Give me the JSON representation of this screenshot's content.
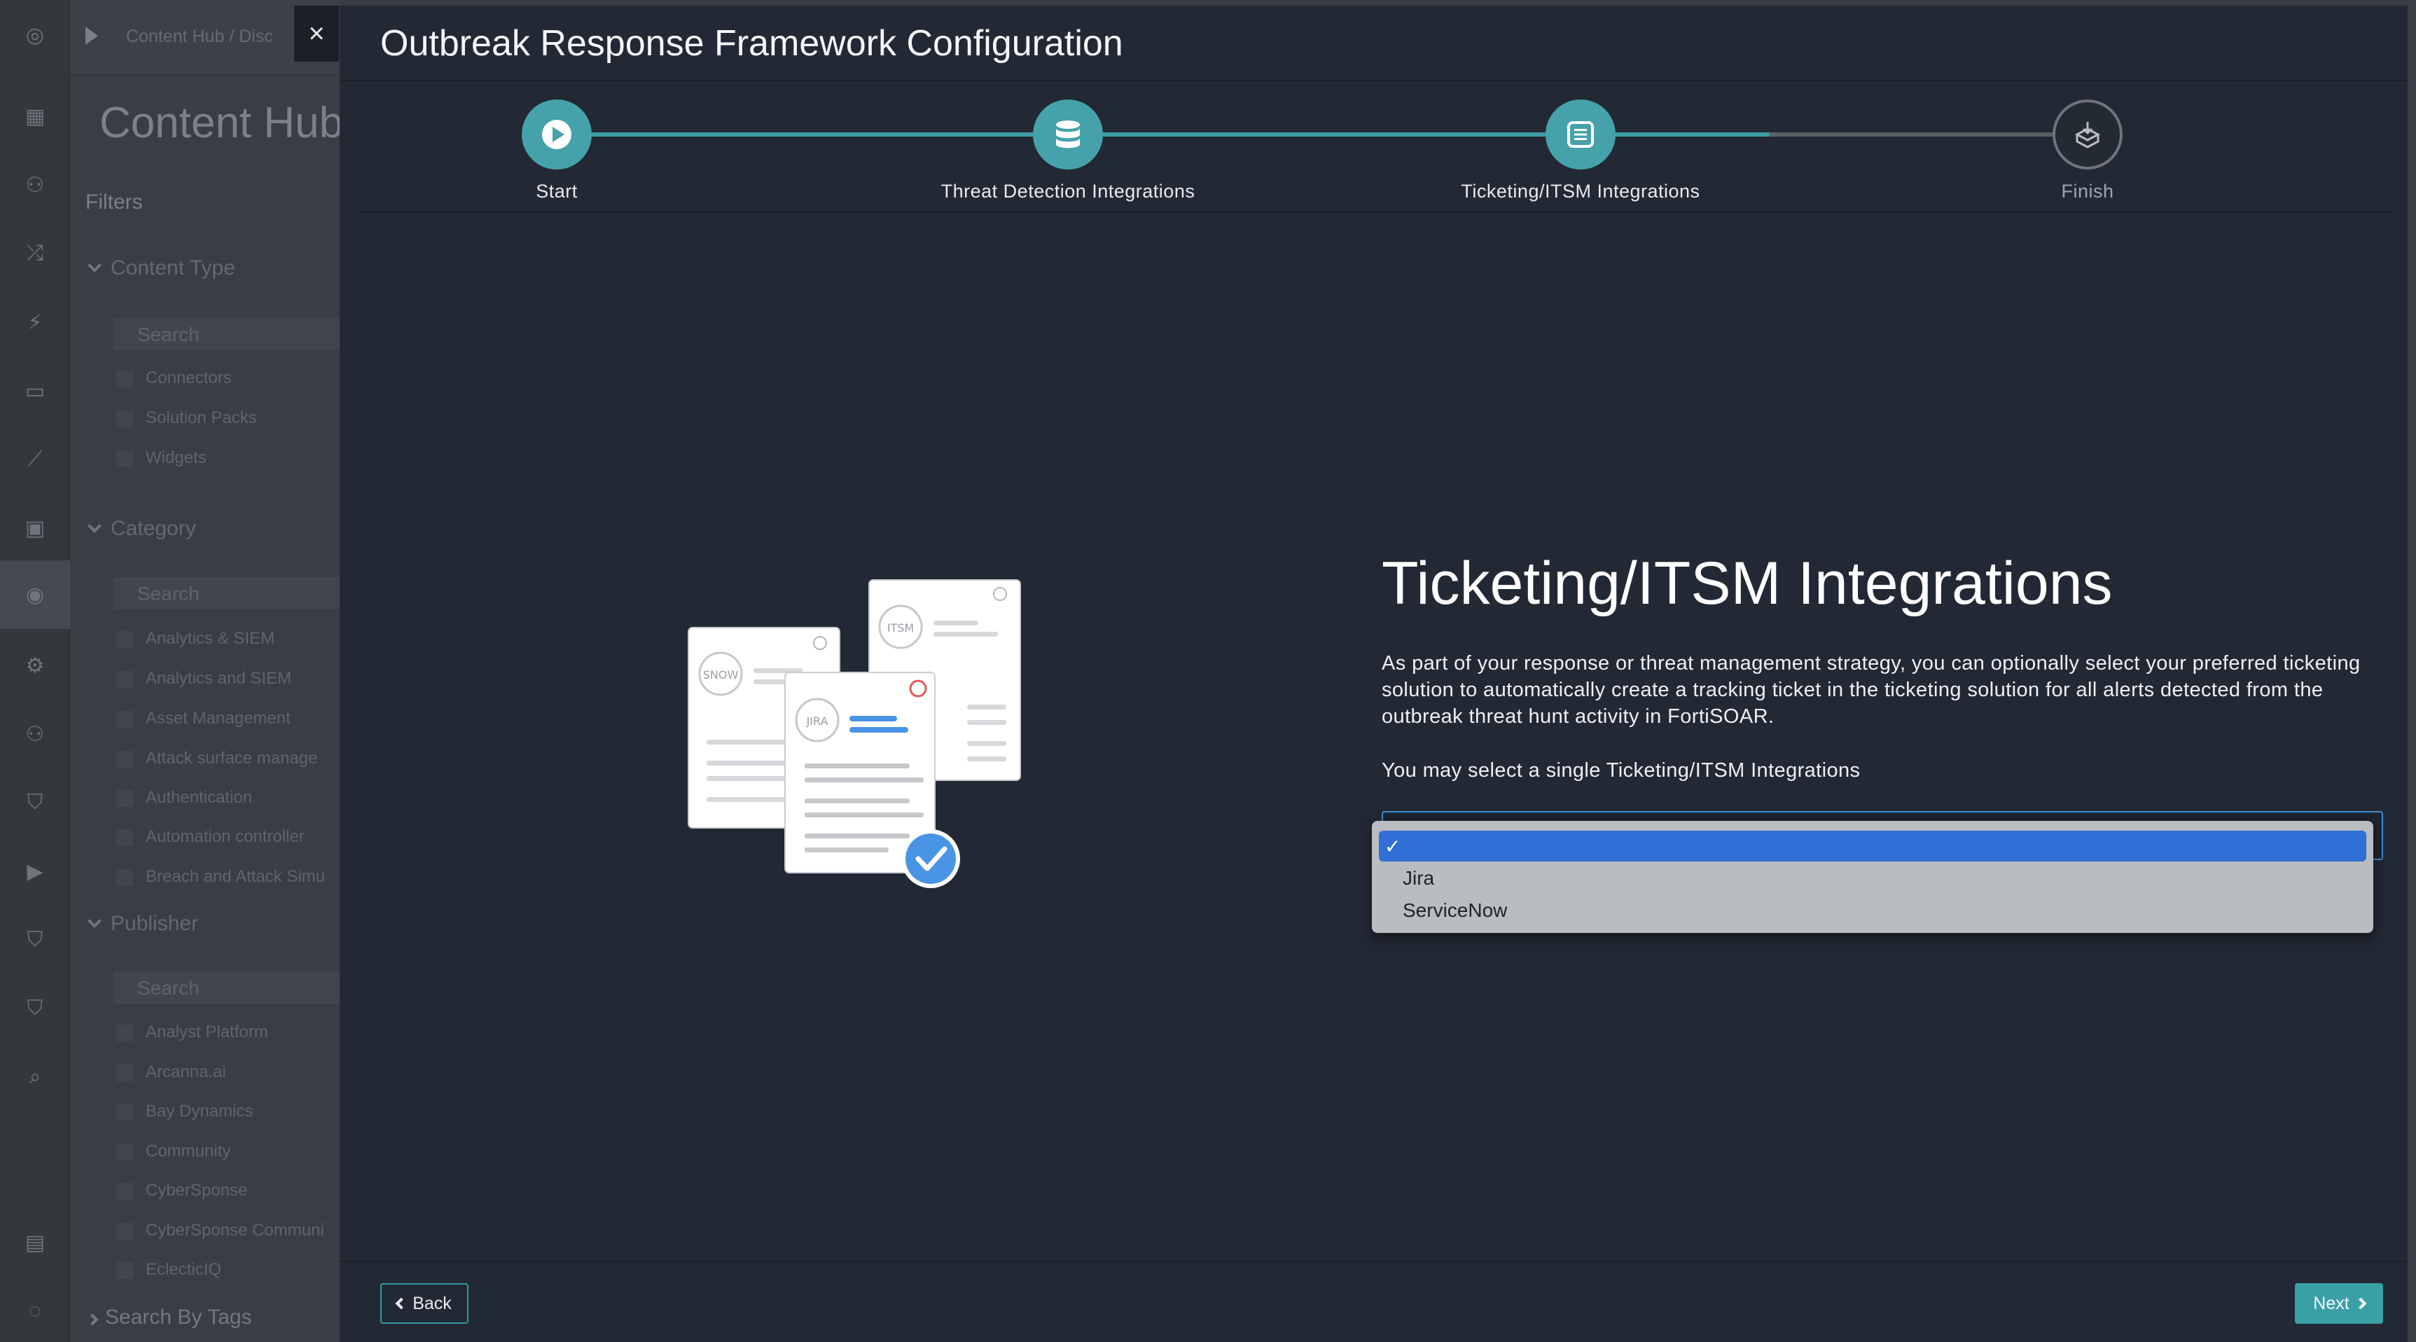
{
  "background_app": {
    "breadcrumb": "Content Hub /  Disc",
    "title": "Content Hub",
    "filters_label": "Filters",
    "sections": {
      "content_type": "Content Type",
      "category": "Category",
      "publisher": "Publisher"
    },
    "search_placeholder": "Search",
    "content_type_items": [
      "Connectors",
      "Solution Packs",
      "Widgets"
    ],
    "category_items": [
      "Analytics & SIEM",
      "Analytics and SIEM",
      "Asset Management",
      "Attack surface manage",
      "Authentication",
      "Automation controller",
      "Breach and Attack Simu"
    ],
    "publisher_items": [
      "Analyst Platform",
      "Arcanna.ai",
      "Bay Dynamics",
      "Community",
      "CyberSponse",
      "CyberSponse Communi",
      "EclecticIQ"
    ],
    "search_by_tags": "Search By Tags"
  },
  "modal": {
    "close_label": "×",
    "title": "Outbreak Response Framework Configuration",
    "steps": [
      {
        "label": "Start",
        "status": "complete",
        "icon": "play-icon"
      },
      {
        "label": "Threat Detection Integrations",
        "status": "complete",
        "icon": "database-icon"
      },
      {
        "label": "Ticketing/ITSM Integrations",
        "status": "current",
        "icon": "list-icon"
      },
      {
        "label": "Finish",
        "status": "pending",
        "icon": "finish-icon"
      }
    ],
    "illustration": {
      "cards": [
        "SNOW",
        "ITSM",
        "JIRA"
      ]
    },
    "heading": "Ticketing/ITSM Integrations",
    "description": "As part of your response or threat management strategy, you can optionally select your preferred ticketing solution to automatically create a tracking ticket in the ticketing solution for all alerts detected from the outbreak threat hunt activity in FortiSOAR.",
    "note": "You may select a single Ticketing/ITSM Integrations",
    "select": {
      "selected_value": "",
      "options": [
        "",
        "Jira",
        "ServiceNow"
      ],
      "checkmark": "✓"
    },
    "back_label": "Back",
    "next_label": "Next"
  },
  "colors": {
    "accent": "#45a2ab",
    "modal_bg": "#222935",
    "selection_blue": "#2f6fd6"
  }
}
